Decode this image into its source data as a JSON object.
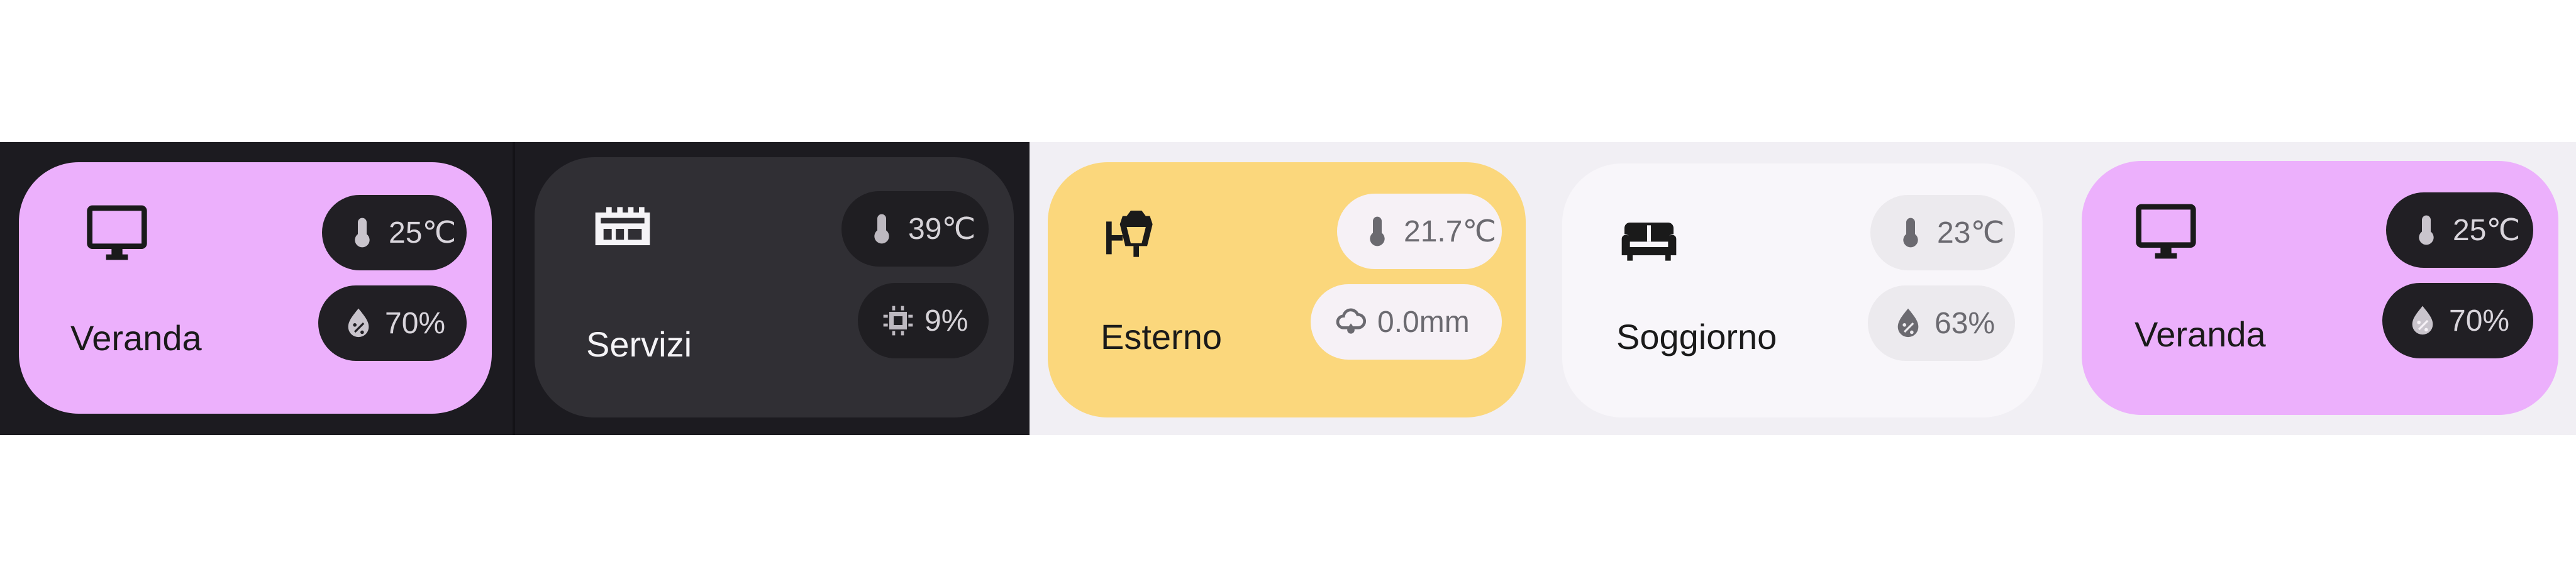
{
  "cards": [
    {
      "name": "Veranda",
      "icon": "monitor-icon",
      "temperature": "25℃",
      "secondary_value": "70%",
      "secondary_icon": "humidity-icon",
      "background": "#ecb0fc"
    },
    {
      "name": "Servizi",
      "icon": "network-device-icon",
      "temperature": "39℃",
      "secondary_value": "9%",
      "secondary_icon": "cpu-icon",
      "background": "#302f34"
    },
    {
      "name": "Esterno",
      "icon": "outdoor-lamp-icon",
      "temperature": "21.7℃",
      "secondary_value": "0.0mm",
      "secondary_icon": "rain-cloud-icon",
      "background": "#fbd77c"
    },
    {
      "name": "Soggiorno",
      "icon": "sofa-icon",
      "temperature": "23℃",
      "secondary_value": "63%",
      "secondary_icon": "humidity-icon",
      "background": "#f8f6fa"
    },
    {
      "name": "Veranda",
      "icon": "monitor-icon",
      "temperature": "25℃",
      "secondary_value": "70%",
      "secondary_icon": "humidity-icon",
      "background": "#ecb0fc"
    }
  ]
}
